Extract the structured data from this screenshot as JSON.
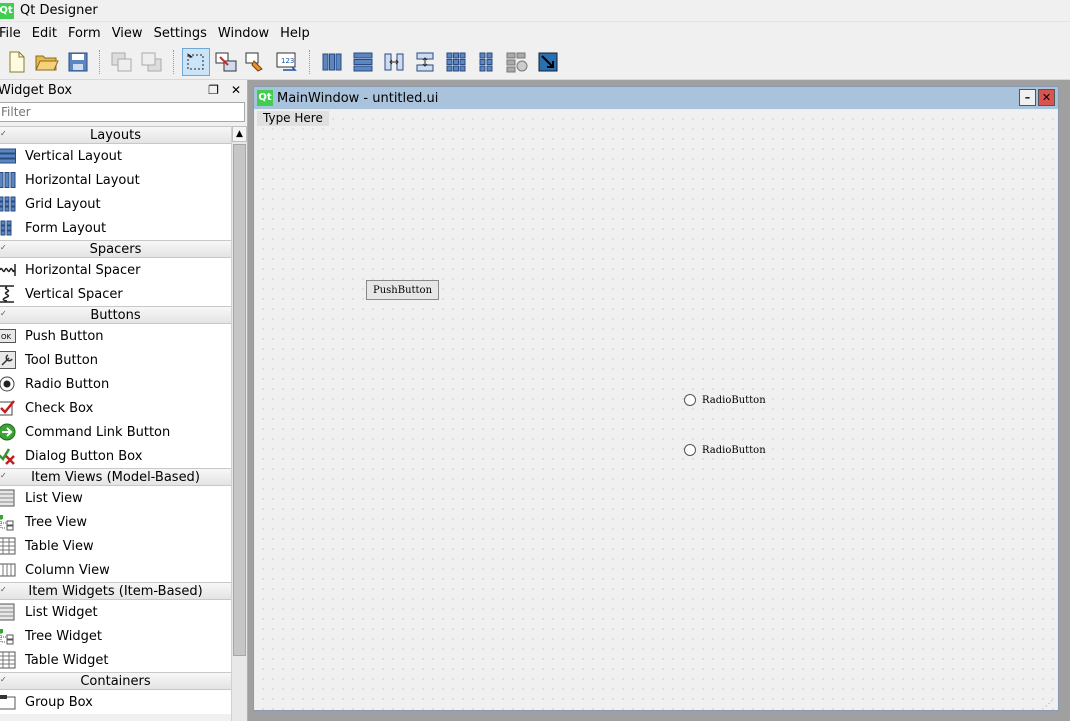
{
  "app": {
    "title": "Qt Designer",
    "logo": "Qt"
  },
  "menu": [
    "File",
    "Edit",
    "Form",
    "View",
    "Settings",
    "Window",
    "Help"
  ],
  "toolbar": {
    "icons": [
      "new-file-icon",
      "open-folder-icon",
      "save-icon",
      "send-to-back-icon",
      "bring-to-front-icon",
      "edit-widgets-icon",
      "edit-signals-slots-icon",
      "edit-buddies-icon",
      "edit-tab-order-icon",
      "layout-horizontal-icon",
      "layout-vertical-icon",
      "layout-horizontal-splitter-icon",
      "layout-vertical-splitter-icon",
      "layout-grid-icon",
      "layout-form-icon",
      "break-layout-icon",
      "adjust-size-icon"
    ]
  },
  "widget_box": {
    "title": "Widget Box",
    "filter_placeholder": "Filter",
    "categories": [
      {
        "name": "Layouts",
        "items": [
          {
            "label": "Vertical Layout",
            "icon": "vertical-layout-icon"
          },
          {
            "label": "Horizontal Layout",
            "icon": "horizontal-layout-icon"
          },
          {
            "label": "Grid Layout",
            "icon": "grid-layout-icon"
          },
          {
            "label": "Form Layout",
            "icon": "form-layout-icon"
          }
        ]
      },
      {
        "name": "Spacers",
        "items": [
          {
            "label": "Horizontal Spacer",
            "icon": "horizontal-spacer-icon"
          },
          {
            "label": "Vertical Spacer",
            "icon": "vertical-spacer-icon"
          }
        ]
      },
      {
        "name": "Buttons",
        "items": [
          {
            "label": "Push Button",
            "icon": "push-button-icon"
          },
          {
            "label": "Tool Button",
            "icon": "tool-button-icon"
          },
          {
            "label": "Radio Button",
            "icon": "radio-button-icon"
          },
          {
            "label": "Check Box",
            "icon": "check-box-icon"
          },
          {
            "label": "Command Link Button",
            "icon": "command-link-icon"
          },
          {
            "label": "Dialog Button Box",
            "icon": "dialog-button-box-icon"
          }
        ]
      },
      {
        "name": "Item Views (Model-Based)",
        "items": [
          {
            "label": "List View",
            "icon": "list-view-icon"
          },
          {
            "label": "Tree View",
            "icon": "tree-view-icon"
          },
          {
            "label": "Table View",
            "icon": "table-view-icon"
          },
          {
            "label": "Column View",
            "icon": "column-view-icon"
          }
        ]
      },
      {
        "name": "Item Widgets (Item-Based)",
        "items": [
          {
            "label": "List Widget",
            "icon": "list-widget-icon"
          },
          {
            "label": "Tree Widget",
            "icon": "tree-widget-icon"
          },
          {
            "label": "Table Widget",
            "icon": "table-widget-icon"
          }
        ]
      },
      {
        "name": "Containers",
        "items": [
          {
            "label": "Group Box",
            "icon": "group-box-icon"
          }
        ]
      }
    ]
  },
  "form_window": {
    "title": "MainWindow - untitled.ui",
    "menubar_placeholder": "Type Here",
    "push_button": "PushButton",
    "radio_buttons": [
      "RadioButton",
      "RadioButton"
    ]
  }
}
